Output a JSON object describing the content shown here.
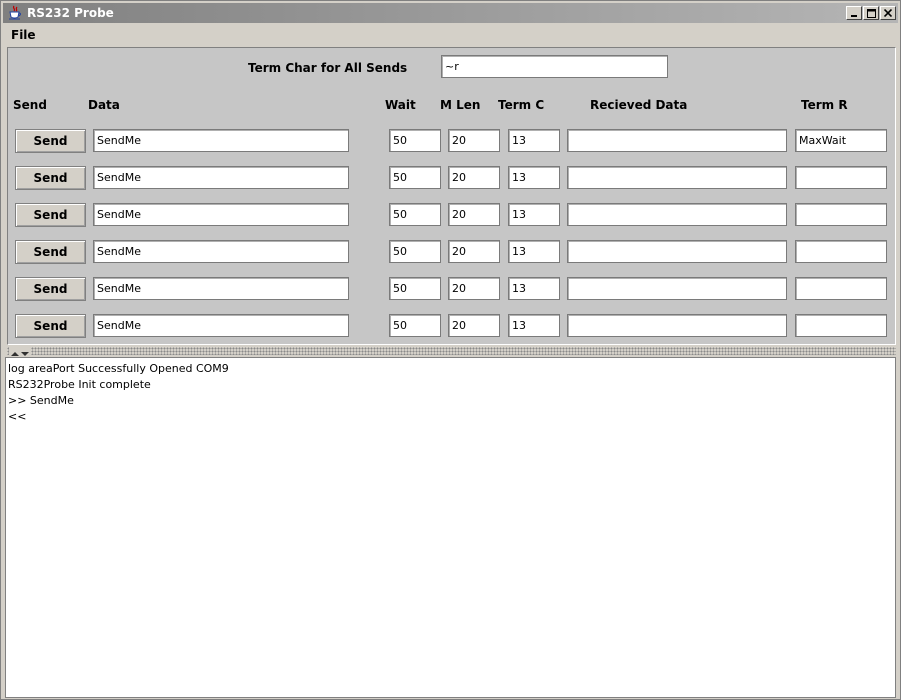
{
  "window": {
    "title": "RS232 Probe"
  },
  "menu": {
    "file_label": "File"
  },
  "term_char": {
    "label": "Term Char for All Sends",
    "value": "~r"
  },
  "headers": {
    "send": "Send",
    "data": "Data",
    "wait": "Wait",
    "mlen": "M Len",
    "termc": "Term C",
    "received": "Recieved Data",
    "termr": "Term R"
  },
  "rows": [
    {
      "send_label": "Send",
      "data": "SendMe",
      "wait": "50",
      "mlen": "20",
      "termc": "13",
      "received": "",
      "termr": "MaxWait"
    },
    {
      "send_label": "Send",
      "data": "SendMe",
      "wait": "50",
      "mlen": "20",
      "termc": "13",
      "received": "",
      "termr": ""
    },
    {
      "send_label": "Send",
      "data": "SendMe",
      "wait": "50",
      "mlen": "20",
      "termc": "13",
      "received": "",
      "termr": ""
    },
    {
      "send_label": "Send",
      "data": "SendMe",
      "wait": "50",
      "mlen": "20",
      "termc": "13",
      "received": "",
      "termr": ""
    },
    {
      "send_label": "Send",
      "data": "SendMe",
      "wait": "50",
      "mlen": "20",
      "termc": "13",
      "received": "",
      "termr": ""
    },
    {
      "send_label": "Send",
      "data": "SendMe",
      "wait": "50",
      "mlen": "20",
      "termc": "13",
      "received": "",
      "termr": ""
    }
  ],
  "log": {
    "lines": [
      "log areaPort Successfully Opened COM9",
      "RS232Probe Init complete",
      ">> SendMe",
      "<<"
    ]
  },
  "icons": {
    "app": "java-cup-icon",
    "minimize": "minimize-icon",
    "maximize": "maximize-icon",
    "close": "close-icon",
    "splitter": "split-arrows-icon"
  }
}
